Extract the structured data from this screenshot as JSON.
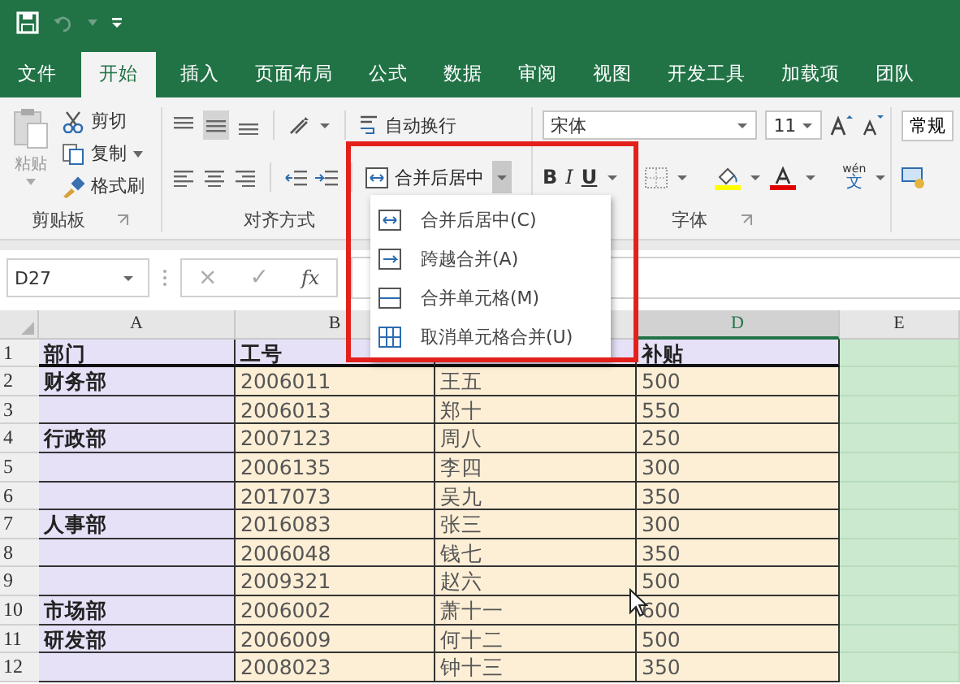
{
  "tabs": [
    {
      "label": "文件",
      "selected": false
    },
    {
      "label": "开始",
      "selected": true
    },
    {
      "label": "插入",
      "selected": false
    },
    {
      "label": "页面布局",
      "selected": false
    },
    {
      "label": "公式",
      "selected": false
    },
    {
      "label": "数据",
      "selected": false
    },
    {
      "label": "审阅",
      "selected": false
    },
    {
      "label": "视图",
      "selected": false
    },
    {
      "label": "开发工具",
      "selected": false
    },
    {
      "label": "加载项",
      "selected": false
    },
    {
      "label": "团队",
      "selected": false
    }
  ],
  "ribbon": {
    "clipboard": {
      "paste": "粘贴",
      "cut": "剪切",
      "copy": "复制",
      "format_painter": "格式刷",
      "label": "剪贴板"
    },
    "alignment": {
      "wrap_text": "自动换行",
      "merge_center": "合并后居中",
      "label": "对齐方式"
    },
    "font": {
      "font_name": "宋体",
      "font_size": "11",
      "bold": "B",
      "italic": "I",
      "underline": "U",
      "phonetic_top": "wén",
      "phonetic_bottom": "文",
      "label": "字体"
    },
    "number": {
      "format": "常规"
    }
  },
  "merge_menu": {
    "items": [
      {
        "kind": "merge-center",
        "label": "合并后居中(C)"
      },
      {
        "kind": "merge-across",
        "label": "跨越合并(A)"
      },
      {
        "kind": "merge-cells",
        "label": "合并单元格(M)"
      },
      {
        "kind": "unmerge",
        "label": "取消单元格合并(U)"
      }
    ]
  },
  "formula_bar": {
    "name_box": "D27",
    "cancel": "×",
    "enter": "✓",
    "function": "fx"
  },
  "sheet": {
    "columns": [
      {
        "letter": "A",
        "color": "#e6e1f7",
        "selected": false
      },
      {
        "letter": "B",
        "color": "#fdefd6",
        "selected": false
      },
      {
        "color": "#fdefd6",
        "selected": false
      },
      {
        "letter": "D",
        "color": "#fdefd6",
        "selected": true
      },
      {
        "letter": "E",
        "color": "#cbe9cf",
        "selected": false
      }
    ],
    "header_row": {
      "number": "1",
      "color": "#e6e1f7",
      "cells": [
        "部门",
        "工号",
        null,
        "补贴",
        null
      ]
    },
    "rows": [
      {
        "number": "2",
        "cells": [
          "财务部",
          "2006011",
          "王五",
          "500",
          null
        ]
      },
      {
        "number": "3",
        "cells": [
          null,
          "2006013",
          "郑十",
          "550",
          null
        ]
      },
      {
        "number": "4",
        "cells": [
          "行政部",
          "2007123",
          "周八",
          "250",
          null
        ]
      },
      {
        "number": "5",
        "cells": [
          null,
          "2006135",
          "李四",
          "300",
          null
        ]
      },
      {
        "number": "6",
        "cells": [
          null,
          "2017073",
          "吴九",
          "350",
          null
        ]
      },
      {
        "number": "7",
        "cells": [
          "人事部",
          "2016083",
          "张三",
          "300",
          null
        ]
      },
      {
        "number": "8",
        "cells": [
          null,
          "2006048",
          "钱七",
          "350",
          null
        ]
      },
      {
        "number": "9",
        "cells": [
          null,
          "2009321",
          "赵六",
          "500",
          null
        ]
      },
      {
        "number": "10",
        "cells": [
          "市场部",
          "2006002",
          "萧十一",
          "600",
          null
        ]
      },
      {
        "number": "11",
        "cells": [
          "研发部",
          "2006009",
          "何十二",
          "500",
          null
        ]
      },
      {
        "number": "12",
        "cells": [
          null,
          "2008023",
          "钟十三",
          "350",
          null
        ]
      }
    ]
  }
}
